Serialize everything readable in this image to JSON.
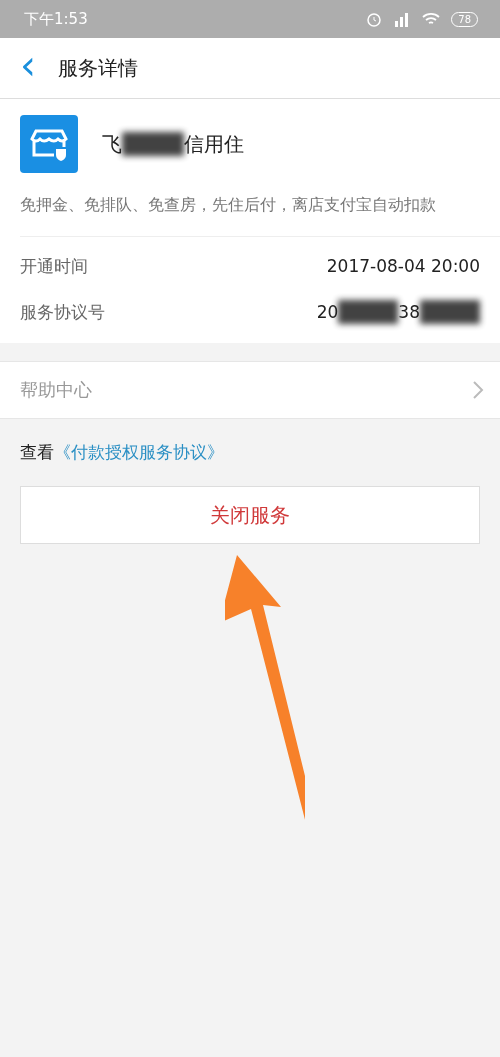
{
  "status_bar": {
    "time": "下午1:53",
    "battery": "78"
  },
  "header": {
    "back": "‹",
    "title": "服务详情"
  },
  "service": {
    "name_parts": [
      "飞",
      "信用住"
    ],
    "description": "免押金、免排队、免查房，先住后付，离店支付宝自动扣款"
  },
  "details": [
    {
      "label": "开通时间",
      "value_parts": [
        "2017-08-04 20:00"
      ]
    },
    {
      "label": "服务协议号",
      "value_parts": [
        "20",
        "38"
      ]
    }
  ],
  "help": {
    "label": "帮助中心"
  },
  "agreement": {
    "prefix": "查看",
    "link": "《付款授权服务协议》"
  },
  "close_button": "关闭服务"
}
